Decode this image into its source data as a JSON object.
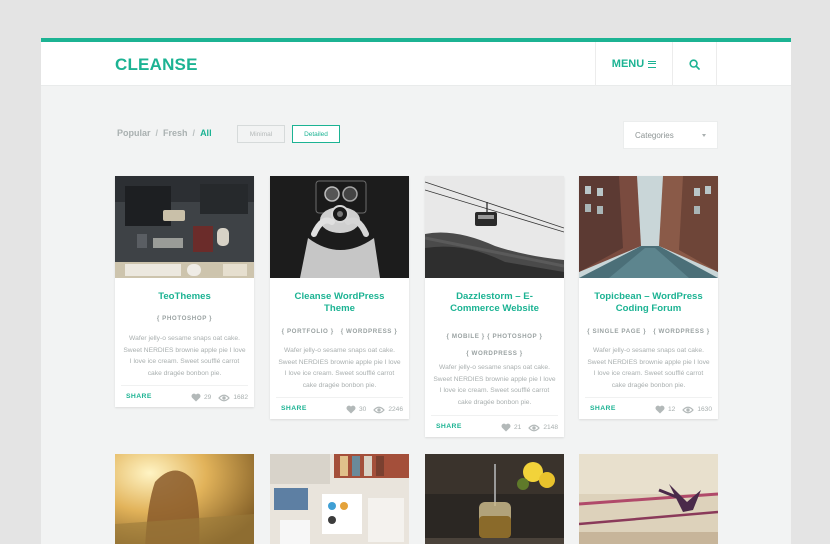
{
  "brand": {
    "logo": "CLEANSE",
    "accent": "#1cb393"
  },
  "header": {
    "menu_label": "MENU",
    "menu_icon": "hamburger-icon",
    "search_icon": "search-icon"
  },
  "filters": {
    "breadcrumbs": [
      "Popular",
      "Fresh",
      "All"
    ],
    "separator": "/",
    "view_minimal": "Minimal",
    "view_detailed": "Detailed",
    "categories_label": "Categories"
  },
  "cards": [
    {
      "title": "TeoThemes",
      "tags": "{ PHOTOSHOP }",
      "desc": "Wafer jelly-o sesame snaps oat cake. Sweet NERDIES brownie apple pie I love I love ice cream. Sweet soufflé carrot cake dragée bonbon pie.",
      "share": "SHARE",
      "likes": "29",
      "views": "1682"
    },
    {
      "title": "Cleanse WordPress Theme",
      "tags": "{ PORTFOLIO }   { WORDPRESS }",
      "desc": "Wafer jelly-o sesame snaps oat cake. Sweet NERDIES brownie apple pie I love I love ice cream. Sweet soufflé carrot cake dragée bonbon pie.",
      "share": "SHARE",
      "likes": "30",
      "views": "2246"
    },
    {
      "title": "Dazzlestorm – E-Commerce Website",
      "tags": "{ MOBILE }   { PHOTOSHOP }\n{ WORDPRESS }",
      "desc": "Wafer jelly-o sesame snaps oat cake. Sweet NERDIES brownie apple pie I love I love ice cream. Sweet soufflé carrot cake dragée bonbon pie.",
      "share": "SHARE",
      "likes": "21",
      "views": "2148"
    },
    {
      "title": "Topicbean – WordPress Coding Forum",
      "tags": "{ SINGLE PAGE }   { WORDPRESS }",
      "desc": "Wafer jelly-o sesame snaps oat cake. Sweet NERDIES brownie apple pie I love I love ice cream. Sweet soufflé carrot cake dragée bonbon pie.",
      "share": "SHARE",
      "likes": "12",
      "views": "1630"
    }
  ],
  "icons": {
    "like": "heart-icon",
    "views": "eye-icon"
  }
}
